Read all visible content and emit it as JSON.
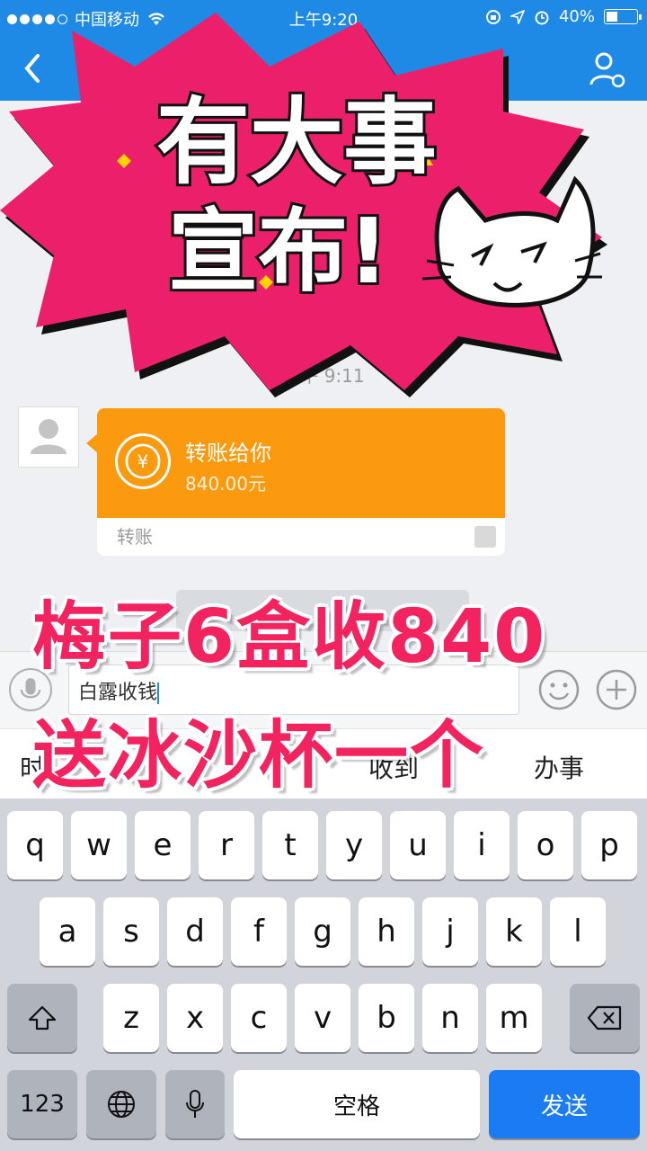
{
  "status_bar": {
    "carrier": "中国移动",
    "time": "上午9:20",
    "battery": "40%",
    "battery_level": 0.4
  },
  "chat": {
    "timestamp": "上午 9:11",
    "transfer": {
      "title": "转账给你",
      "amount": "840.00元",
      "footer": "转账"
    }
  },
  "input": {
    "text": "白露收钱"
  },
  "candidates": [
    "时",
    "收到",
    "办事"
  ],
  "keyboard": {
    "row1": [
      "q",
      "w",
      "e",
      "r",
      "t",
      "y",
      "u",
      "i",
      "o",
      "p"
    ],
    "row2": [
      "a",
      "s",
      "d",
      "f",
      "g",
      "h",
      "j",
      "k",
      "l"
    ],
    "row3": [
      "z",
      "x",
      "c",
      "v",
      "b",
      "n",
      "m"
    ],
    "num_label": "123",
    "space_label": "空格",
    "send_label": "发送"
  },
  "overlay": {
    "sticker_line1": "有大事",
    "sticker_line2": "宣布!",
    "caption_line1": "梅子6盒收840",
    "caption_line2": "送冰沙杯一个"
  },
  "colors": {
    "nav": "#1e8ae6",
    "transfer_card": "#fc9a0f",
    "sticker_pink": "#ec1f6a",
    "caption_pink": "#f2235f",
    "send_key": "#1b7bf2"
  }
}
